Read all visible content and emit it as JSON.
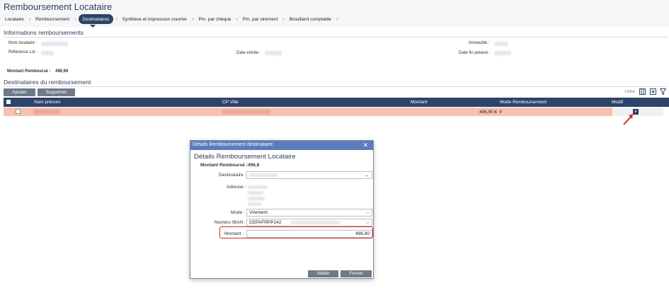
{
  "page": {
    "title": "Remboursement Locataire",
    "steps": [
      "Locataire",
      "Remboursement",
      "Destinataires",
      "Synthèse et impression courrier",
      "Pm. par chèque",
      "Pm. par virement",
      "Brouillard comptable"
    ],
    "active_step": "Destinataires"
  },
  "info": {
    "section_title": "Informations remboursements",
    "nom_locataire_label": "Nom locataire :",
    "reference_lot_label": "Référence Lot :",
    "date_entree_label": "Date entrée :",
    "immeuble_label": "Immeuble :",
    "date_fin_preavis_label": "Date fin préavis :",
    "montant_rembourse_label": "Montant Remboursé :",
    "montant_rembourse_value": "496,90"
  },
  "destinataires": {
    "section_title": "Destinataires du remboursement",
    "add_label": "Ajouter",
    "delete_label": "Supprimer",
    "count_label": "1 fiche",
    "columns": {
      "nom": "Nom prénom",
      "cp_ville": "CP Ville",
      "montant": "Montant",
      "mode": "Mode Remboursement",
      "modif": "Modif"
    },
    "row": {
      "montant": "496,90 €",
      "mode": "V"
    }
  },
  "modal": {
    "header": "Détails Remboursement destinataire",
    "title": "Détails Remboursement Locataire",
    "montant_rembourse_label": "Montant Remboursé :",
    "montant_rembourse_value": "496,9",
    "destinataire_label": "Destinataire :",
    "adresse_label": "Adresse :",
    "mode_label": "Mode :",
    "mode_value": "Virement",
    "iban_label": "Numéro IBAN :",
    "iban_value": "CEPAFRPP142",
    "montant_label": "Montant :",
    "montant_value": "496,90",
    "validate_label": "Valider",
    "close_label": "Fermer"
  },
  "colors": {
    "primary": "#2e4369",
    "row_highlight": "#f6c1ae",
    "modal_header": "#5a7dbd",
    "annotation": "#d62828"
  }
}
